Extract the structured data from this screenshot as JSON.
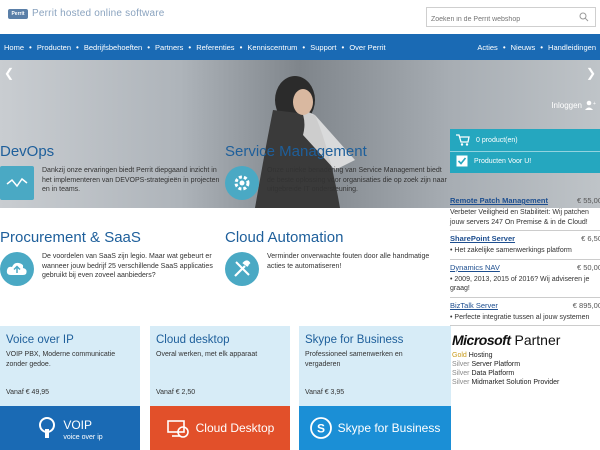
{
  "header": {
    "logo_mark": "Perrit",
    "logo_text": "Perrit hosted online software",
    "search_placeholder": "Zoeken in de Perrit webshop"
  },
  "nav": {
    "left": [
      "Home",
      "Producten",
      "Bedrijfsbehoeften",
      "Partners",
      "Referenties",
      "Kenniscentrum",
      "Support",
      "Over Perrit"
    ],
    "right": [
      "Acties",
      "Nieuws",
      "Handleidingen"
    ]
  },
  "hero": {
    "login": "Inloggen",
    "cart_count": "0 product(en)",
    "cart_link": "Producten Voor U!"
  },
  "sections": {
    "devops": {
      "title": "DevOps",
      "text": "Dankzij onze ervaringen biedt Perrit diepgaand inzicht in het implementeren van DEVOPS-strategieën in projecten en in teams."
    },
    "service": {
      "title": "Service Management",
      "text": "Onze unieke benadering van Service Management biedt de  beste oplossing voor organisaties die op zoek zijn naar uitgebreide IT ondersteuning."
    },
    "procurement": {
      "title": "Procurement & SaaS",
      "text": "De voordelen van SaaS zijn legio. Maar wat gebeurt er wanneer jouw bedrijf 25 verschillende SaaS applicaties gebruikt bij even zoveel aanbieders?"
    },
    "automation": {
      "title": "Cloud Automation",
      "text": "Verminder onverwachte fouten door alle handmatige acties te automatiseren!"
    }
  },
  "news": [
    {
      "title": "Remote Patch Management",
      "price": "€ 55,00",
      "desc": "Verbeter Veiligheid en Stabiliteit: Wij patchen jouw servers 247 On Premise & in de Cloud!"
    },
    {
      "title": "SharePoint Server",
      "price": "€ 6,50",
      "desc": "• Het zakelijke samenwerkings platform"
    },
    {
      "title": "Dynamics NAV",
      "price": "€ 50,00",
      "desc": "• 2009, 2013, 2015 of 2016? Wij adviseren je graag!"
    },
    {
      "title": "BizTalk Server",
      "price": "€ 895,00",
      "desc": "• Perfecte integratie tussen al jouw systemen"
    }
  ],
  "partner": {
    "brand": "Microsoft",
    "word": "Partner",
    "lines": [
      {
        "level": "Gold",
        "text": "Hosting"
      },
      {
        "level": "Silver",
        "text": "Server Platform"
      },
      {
        "level": "Silver",
        "text": "Data Platform"
      },
      {
        "level": "Silver",
        "text": "Midmarket Solution Provider"
      }
    ]
  },
  "tiles": [
    {
      "title": "Voice over IP",
      "desc": "VOIP PBX, Moderne communicatie zonder gedoe.",
      "price": "Vanaf € 49,95",
      "banner": "VOIP",
      "banner_sub": "voice over ip",
      "color": "#1a6ab4"
    },
    {
      "title": "Cloud desktop",
      "desc": "Overal werken, met elk apparaat",
      "price": "Vanaf € 2,50",
      "banner": "Cloud Desktop",
      "banner_sub": "",
      "color": "#e2502a"
    },
    {
      "title": "Skype for Business",
      "desc": "Professioneel samenwerken en vergaderen",
      "price": "Vanaf € 3,95",
      "banner": "Skype for Business",
      "banner_sub": "",
      "color": "#1b8fd6"
    }
  ]
}
